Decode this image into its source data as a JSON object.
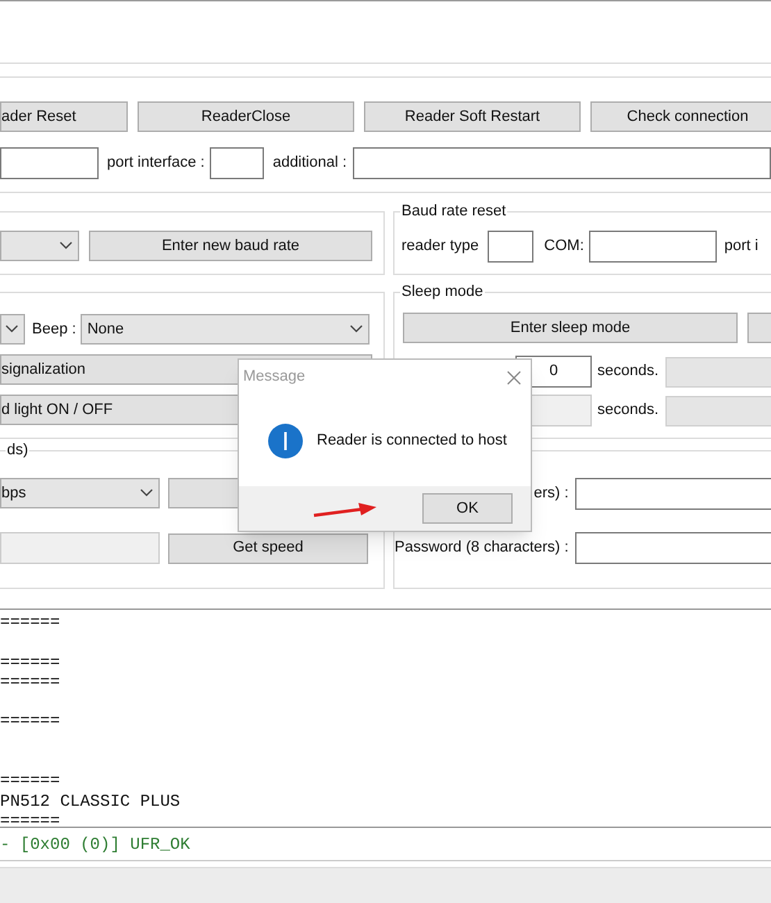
{
  "top_buttons": [
    {
      "label": "ader Reset"
    },
    {
      "label": "ReaderClose"
    },
    {
      "label": "Reader Soft Restart"
    },
    {
      "label": "Check connection"
    }
  ],
  "connection_row": {
    "port_label": "port interface :",
    "additional_label": "additional :"
  },
  "baud_group": {
    "button": "Enter new baud rate"
  },
  "baud_rate_reset": {
    "title": "Baud rate reset",
    "reader_type_label": "reader type",
    "com_label": "COM:",
    "port_label": "port i"
  },
  "signal_group": {
    "beep_label": "Beep :",
    "beep_value": "None",
    "buttons": [
      "signalization",
      "d light ON / OFF"
    ]
  },
  "sleep_mode": {
    "title": "Sleep mode",
    "enter_button": "Enter sleep mode",
    "rows": [
      {
        "value": "0",
        "unit": "seconds.",
        "disabled": false
      },
      {
        "unit": "seconds.",
        "disabled": true
      }
    ]
  },
  "speed_group": {
    "title": "ds)",
    "speed_value": "bps",
    "get_speed": "Get speed"
  },
  "password_group": {
    "rows": [
      {
        "label": "ers) :"
      },
      {
        "label": "Password (8 characters) :"
      }
    ]
  },
  "log": {
    "blocks": [
      [
        "======"
      ],
      [
        "======",
        "======"
      ],
      [
        "======"
      ],
      [
        "======",
        "PN512 CLASSIC PLUS",
        "======"
      ]
    ]
  },
  "status_line": "- [0x00 (0)] UFR_OK",
  "dialog": {
    "title": "Message",
    "message": "Reader is connected to host",
    "button": "OK"
  }
}
